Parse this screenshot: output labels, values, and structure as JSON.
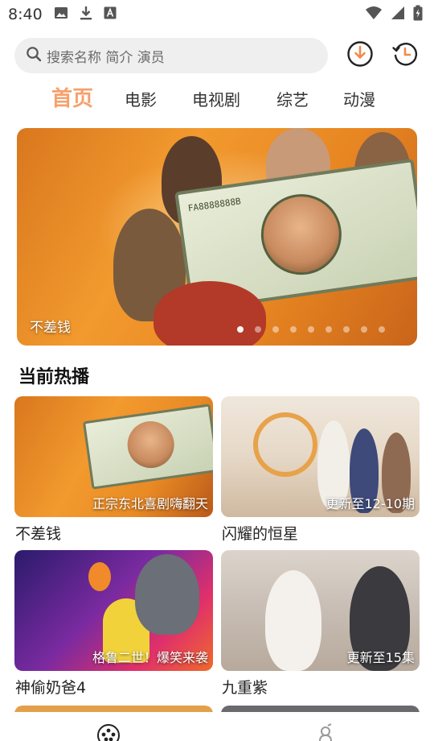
{
  "status_bar": {
    "time": "8:40",
    "left_icons": [
      "image-icon",
      "download-icon",
      "text-badge-icon"
    ],
    "right_icons": [
      "wifi-icon",
      "signal-icon",
      "battery-icon"
    ]
  },
  "search": {
    "placeholder": "搜索名称 简介 演员"
  },
  "header_buttons": [
    "download-circle-icon",
    "history-icon"
  ],
  "tabs": [
    {
      "label": "首页",
      "active": true
    },
    {
      "label": "电影",
      "active": false
    },
    {
      "label": "电视剧",
      "active": false
    },
    {
      "label": "综艺",
      "active": false
    },
    {
      "label": "动漫",
      "active": false
    }
  ],
  "banner": {
    "caption": "不差钱",
    "bill_number": "FA8888888B",
    "dot_count": 10,
    "active_dot": 0
  },
  "section": {
    "title": "当前热播"
  },
  "cards": [
    {
      "title": "不差钱",
      "badge": "正宗东北喜剧嗨翻天"
    },
    {
      "title": "闪耀的恒星",
      "badge": "更新至12-10期"
    },
    {
      "title": "神偷奶爸4",
      "badge": "格鲁二世！爆笑来袭"
    },
    {
      "title": "九重紫",
      "badge": "更新至15集"
    }
  ],
  "bottom_nav": [
    "film-reel-icon",
    "profile-icon"
  ],
  "colors": {
    "accent": "#f7a06b",
    "search_bg": "#efefef"
  }
}
